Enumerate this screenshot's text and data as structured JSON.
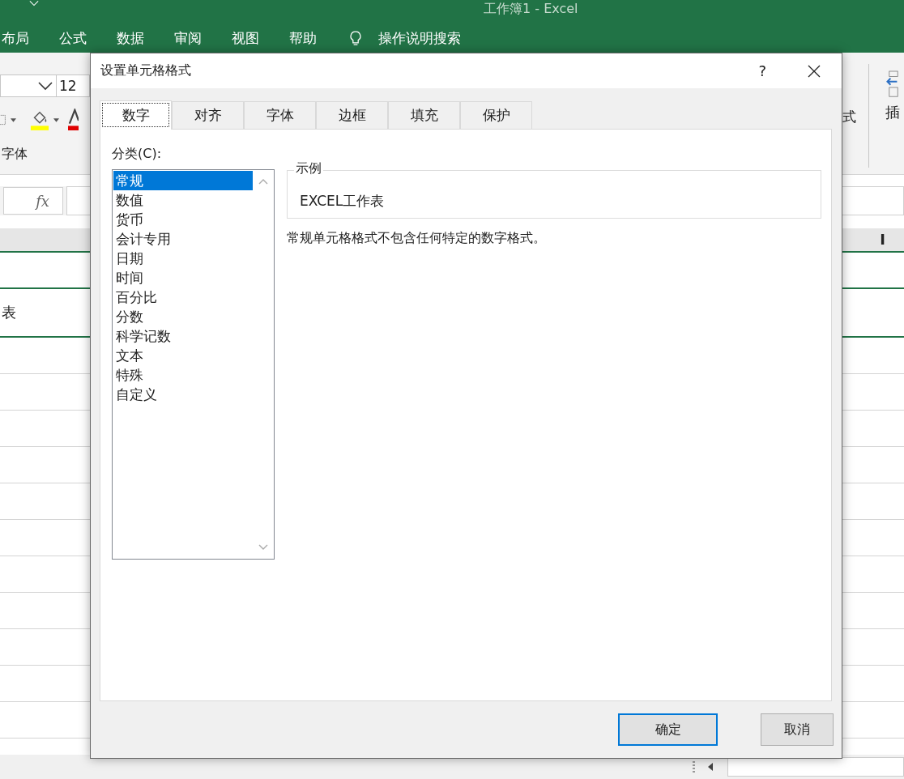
{
  "window": {
    "title": "工作簿1  -  Excel"
  },
  "ribbon_tabs": [
    {
      "label": "布局"
    },
    {
      "label": "公式"
    },
    {
      "label": "数据"
    },
    {
      "label": "审阅"
    },
    {
      "label": "视图"
    },
    {
      "label": "帮助"
    }
  ],
  "tell_me": {
    "label": "操作说明搜索"
  },
  "ribbon": {
    "font_size": "12",
    "group_label": "字体",
    "right_label": "式",
    "insert_label": "插"
  },
  "formula_bar": {
    "fx": "fx"
  },
  "sheet": {
    "column_header": "I",
    "cell_text": "表"
  },
  "dialog": {
    "title": "设置单元格格式",
    "help": "?",
    "tabs": [
      {
        "label": "数字",
        "selected": true
      },
      {
        "label": "对齐",
        "selected": false
      },
      {
        "label": "字体",
        "selected": false
      },
      {
        "label": "边框",
        "selected": false
      },
      {
        "label": "填充",
        "selected": false
      },
      {
        "label": "保护",
        "selected": false
      }
    ],
    "category_label": "分类(C):",
    "categories": [
      {
        "label": "常规",
        "selected": true
      },
      {
        "label": "数值",
        "selected": false
      },
      {
        "label": "货币",
        "selected": false
      },
      {
        "label": "会计专用",
        "selected": false
      },
      {
        "label": "日期",
        "selected": false
      },
      {
        "label": "时间",
        "selected": false
      },
      {
        "label": "百分比",
        "selected": false
      },
      {
        "label": "分数",
        "selected": false
      },
      {
        "label": "科学记数",
        "selected": false
      },
      {
        "label": "文本",
        "selected": false
      },
      {
        "label": "特殊",
        "selected": false
      },
      {
        "label": "自定义",
        "selected": false
      }
    ],
    "sample_label": "示例",
    "sample_value": "EXCEL工作表",
    "description": "常规单元格格式不包含任何特定的数字格式。",
    "buttons": [
      {
        "label": "确定",
        "default": true
      },
      {
        "label": "取消",
        "default": false
      }
    ]
  }
}
